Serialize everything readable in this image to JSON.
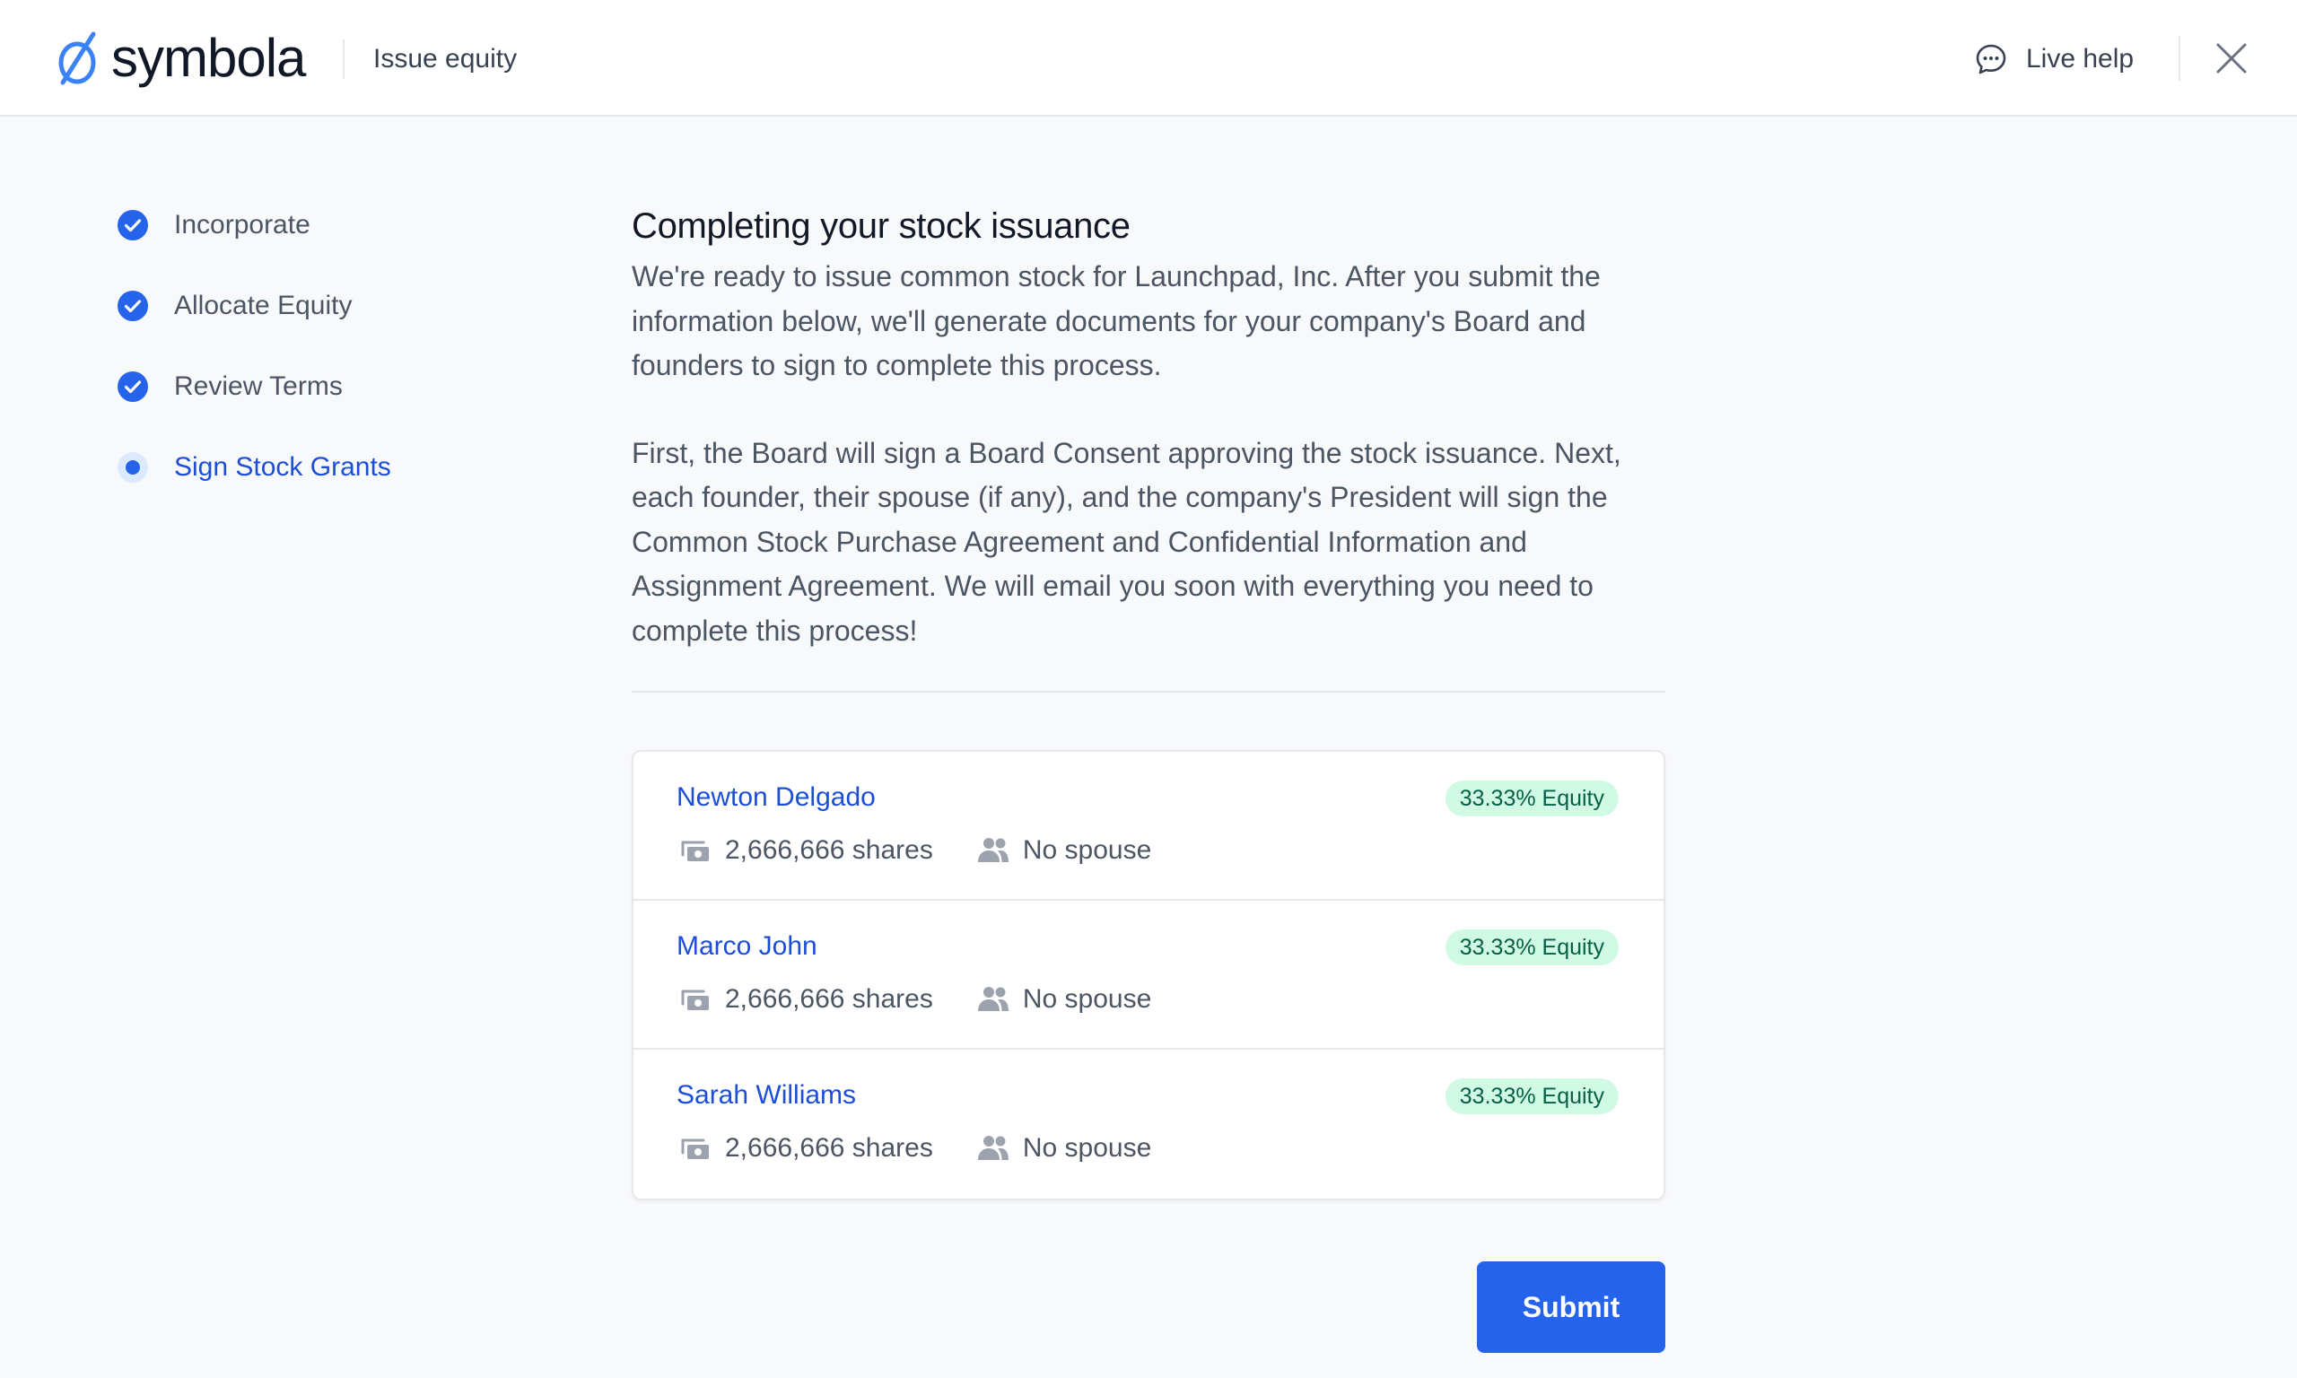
{
  "header": {
    "logo_text": "symbola",
    "title": "Issue equity",
    "live_help": "Live help",
    "live_help_icon": "chat-bubble-icon",
    "close_icon": "close-icon"
  },
  "colors": {
    "accent": "#2563eb",
    "link": "#1d4ed8",
    "badge_bg": "#d1fae5",
    "badge_text": "#065f46"
  },
  "steps": [
    {
      "label": "Incorporate",
      "state": "complete"
    },
    {
      "label": "Allocate Equity",
      "state": "complete"
    },
    {
      "label": "Review Terms",
      "state": "complete"
    },
    {
      "label": "Sign Stock Grants",
      "state": "active"
    }
  ],
  "main": {
    "title": "Completing your stock issuance",
    "paragraph1": "We're ready to issue common stock for Launchpad, Inc. After you submit the information below, we'll generate documents for your company's Board and founders to sign to complete this process.",
    "paragraph2": "First, the Board will sign a Board Consent approving the stock issuance. Next, each founder, their spouse (if any), and the company's President will sign the Common Stock Purchase Agreement and Confidential Information and Assignment Agreement. We will email you soon with everything you need to complete this process!"
  },
  "founders": [
    {
      "name": "Newton Delgado",
      "equity": "33.33% Equity",
      "shares": "2,666,666 shares",
      "spouse": "No spouse"
    },
    {
      "name": "Marco John",
      "equity": "33.33% Equity",
      "shares": "2,666,666 shares",
      "spouse": "No spouse"
    },
    {
      "name": "Sarah Williams",
      "equity": "33.33% Equity",
      "shares": "2,666,666 shares",
      "spouse": "No spouse"
    }
  ],
  "submit_label": "Submit"
}
